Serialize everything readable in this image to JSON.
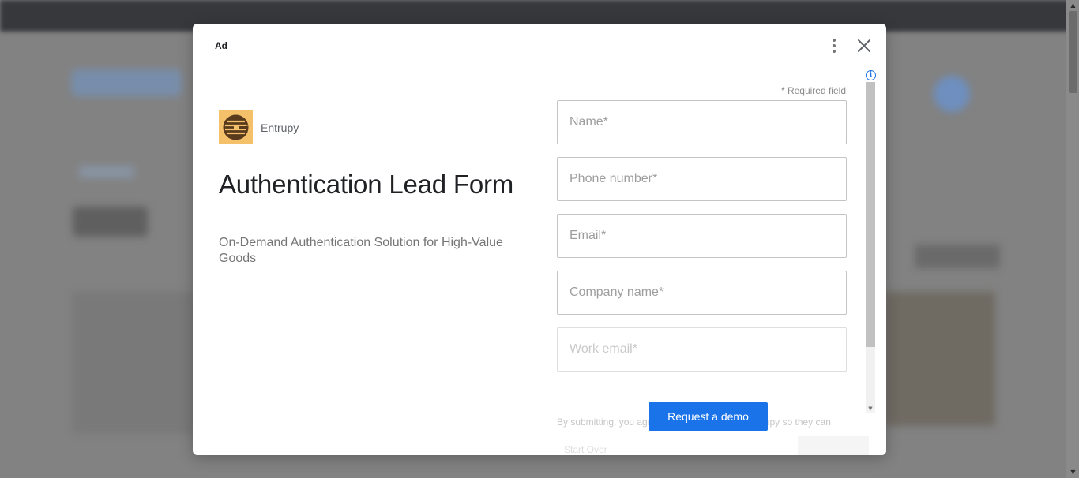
{
  "modal": {
    "ad_label": "Ad",
    "brand_name": "Entrupy",
    "title": "Authentication Lead Form",
    "description": "On-Demand Authentication Solution for High-Value Goods",
    "info_glyph": "i",
    "more_icon": "more-vert-icon",
    "close_icon": "close-icon"
  },
  "form": {
    "required_note": "* Required field",
    "fields": [
      {
        "placeholder": "Name*",
        "value": ""
      },
      {
        "placeholder": "Phone number*",
        "value": ""
      },
      {
        "placeholder": "Email*",
        "value": ""
      },
      {
        "placeholder": "Company name*",
        "value": ""
      },
      {
        "placeholder": "Work email*",
        "value": ""
      }
    ],
    "consent_text": "By submitting, you agree to send your info to Entrupy so they can",
    "back_label": "Start Over",
    "submit_label": "Request a demo"
  },
  "colors": {
    "accent": "#1a73e8",
    "brand_logo_bg": "#f4c06a"
  }
}
